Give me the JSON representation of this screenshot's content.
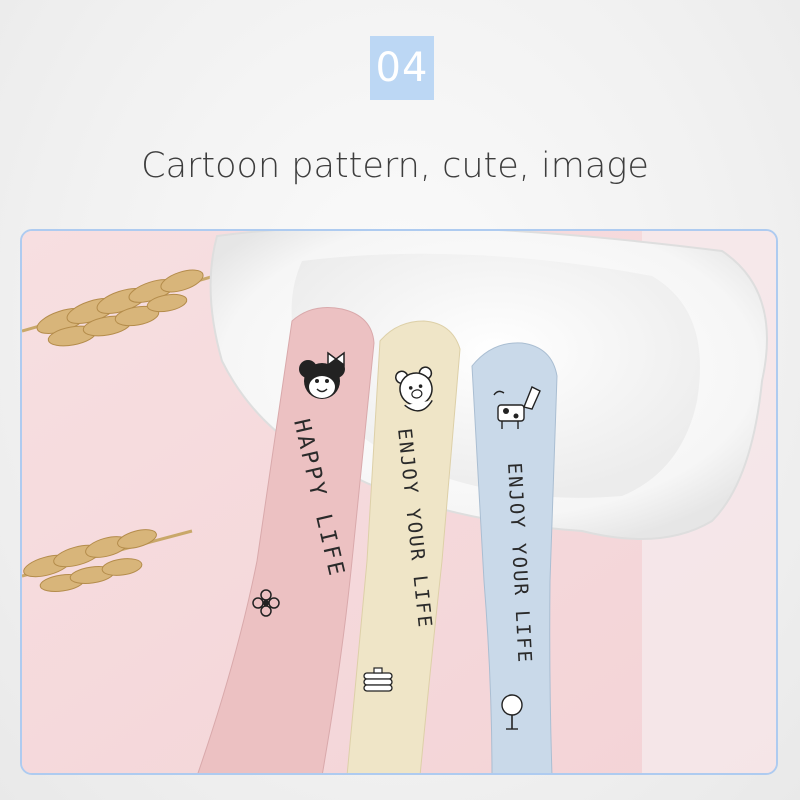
{
  "badge": {
    "number": "04"
  },
  "headline": {
    "text": "Cartoon pattern, cute, image"
  },
  "photo": {
    "spoons": [
      {
        "color": "#ecc1c2",
        "lettering": "HAPPY LIFE",
        "character": "monkey-with-bow",
        "motif": "flower"
      },
      {
        "color": "#efe5c7",
        "lettering": "ENJOY YOUR LIFE",
        "character": "teddy-bear",
        "motif": "pancake-stack"
      },
      {
        "color": "#c9d9e9",
        "lettering": "ENJOY YOUR LIFE",
        "character": "giraffe-and-cow",
        "motif": "tree"
      }
    ]
  },
  "colors": {
    "badge_bg": "#bcd7f4",
    "frame_border": "#aecbf0",
    "photo_bg": "#f5d8da",
    "bowl": "#ffffff"
  }
}
